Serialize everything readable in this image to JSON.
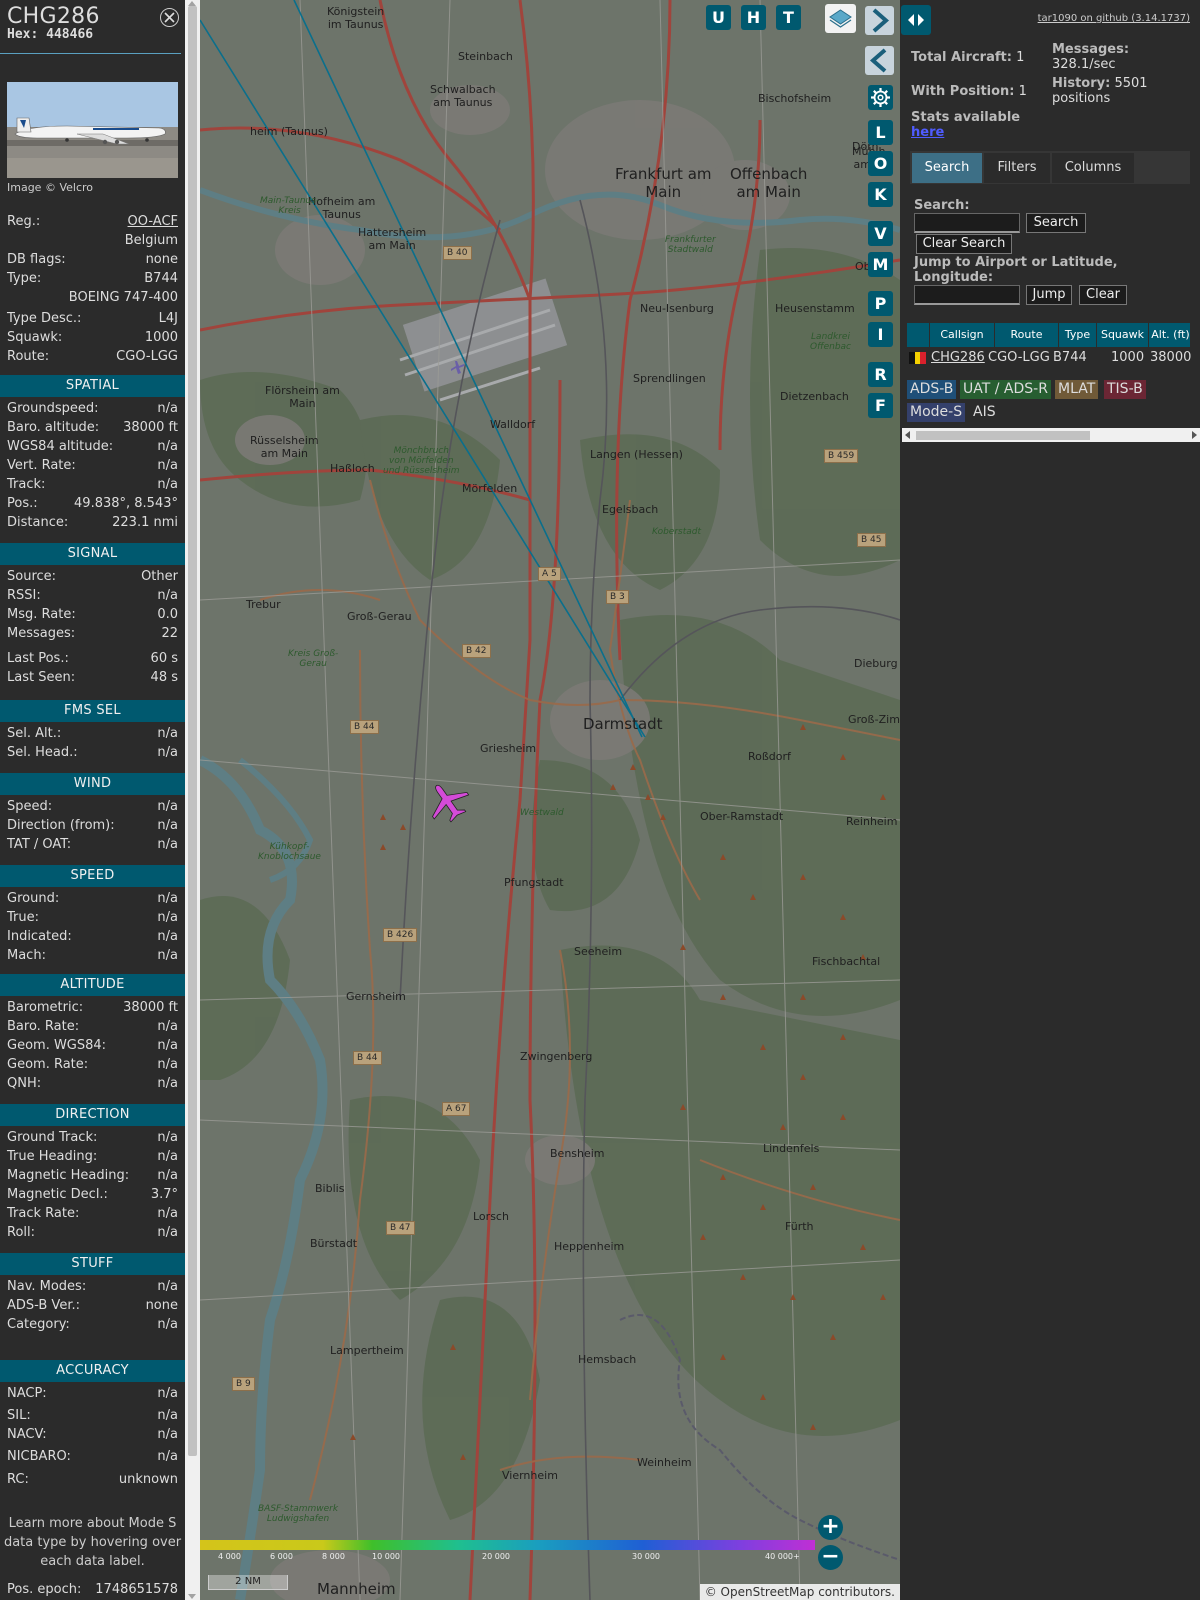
{
  "selected": {
    "callsign": "CHG286",
    "hex": "Hex:  448466",
    "image_credit": "Image © Velcro",
    "fields": [
      {
        "k": "Reg.:",
        "v": "OO-ACF"
      },
      {
        "k": "",
        "v": "Belgium"
      },
      {
        "k": "DB flags:",
        "v": "none"
      },
      {
        "k": "Type:",
        "v": "B744"
      },
      {
        "k": "",
        "v": "BOEING 747-400"
      },
      {
        "k": "Type Desc.:",
        "v": "L4J"
      },
      {
        "k": "Squawk:",
        "v": "1000"
      },
      {
        "k": "Route:",
        "v": "CGO-LGG"
      }
    ]
  },
  "sections": {
    "spatial": {
      "title": "SPATIAL",
      "rows": [
        {
          "k": "Groundspeed:",
          "v": "n/a"
        },
        {
          "k": "Baro. altitude:",
          "v": "38000 ft"
        },
        {
          "k": "WGS84 altitude:",
          "v": "n/a"
        },
        {
          "k": "Vert. Rate:",
          "v": "n/a"
        },
        {
          "k": "Track:",
          "v": "n/a"
        },
        {
          "k": "Pos.:",
          "v": "49.838°, 8.543°"
        },
        {
          "k": "Distance:",
          "v": "223.1 nmi"
        }
      ]
    },
    "signal": {
      "title": "SIGNAL",
      "rows": [
        {
          "k": "Source:",
          "v": "Other"
        },
        {
          "k": "RSSI:",
          "v": "n/a"
        },
        {
          "k": "Msg. Rate:",
          "v": "0.0"
        },
        {
          "k": "Messages:",
          "v": "22"
        },
        {
          "k": "Last Pos.:",
          "v": "60 s"
        },
        {
          "k": "Last Seen:",
          "v": "48 s"
        }
      ]
    },
    "fms": {
      "title": "FMS SEL",
      "rows": [
        {
          "k": "Sel. Alt.:",
          "v": "n/a"
        },
        {
          "k": "Sel. Head.:",
          "v": "n/a"
        }
      ]
    },
    "wind": {
      "title": "WIND",
      "rows": [
        {
          "k": "Speed:",
          "v": "n/a"
        },
        {
          "k": "Direction (from):",
          "v": "n/a"
        },
        {
          "k": "TAT / OAT:",
          "v": "n/a"
        }
      ]
    },
    "speed": {
      "title": "SPEED",
      "rows": [
        {
          "k": "Ground:",
          "v": "n/a"
        },
        {
          "k": "True:",
          "v": "n/a"
        },
        {
          "k": "Indicated:",
          "v": "n/a"
        },
        {
          "k": "Mach:",
          "v": "n/a"
        }
      ]
    },
    "altitude": {
      "title": "ALTITUDE",
      "rows": [
        {
          "k": "Barometric:",
          "v": "38000 ft"
        },
        {
          "k": "Baro. Rate:",
          "v": "n/a"
        },
        {
          "k": "Geom. WGS84:",
          "v": "n/a"
        },
        {
          "k": "Geom. Rate:",
          "v": "n/a"
        },
        {
          "k": "QNH:",
          "v": "n/a"
        }
      ]
    },
    "direction": {
      "title": "DIRECTION",
      "rows": [
        {
          "k": "Ground Track:",
          "v": "n/a"
        },
        {
          "k": "True Heading:",
          "v": "n/a"
        },
        {
          "k": "Magnetic Heading:",
          "v": "n/a"
        },
        {
          "k": "Magnetic Decl.:",
          "v": "3.7°"
        },
        {
          "k": "Track Rate:",
          "v": "n/a"
        },
        {
          "k": "Roll:",
          "v": "n/a"
        }
      ]
    },
    "stuff": {
      "title": "STUFF",
      "rows": [
        {
          "k": "Nav. Modes:",
          "v": "n/a"
        },
        {
          "k": "ADS-B Ver.:",
          "v": "none"
        },
        {
          "k": "Category:",
          "v": "n/a"
        }
      ]
    },
    "accuracy": {
      "title": "ACCURACY",
      "rows": [
        {
          "k": "NACP:",
          "v": "n/a"
        },
        {
          "k": "SIL:",
          "v": "n/a"
        },
        {
          "k": "NACV:",
          "v": "n/a"
        },
        {
          "k": "NICBARO:",
          "v": "n/a"
        },
        {
          "k": "RC:",
          "v": "unknown"
        }
      ]
    },
    "note_lines": [
      "Learn more about Mode S",
      "data type by hovering over",
      "each data label."
    ],
    "epoch": {
      "k": "Pos. epoch:",
      "v": "1748651578"
    }
  },
  "map": {
    "top_buttons": [
      "U",
      "H",
      "T"
    ],
    "side_buttons": [
      "L",
      "O",
      "K",
      "V",
      "M",
      "P",
      "I",
      "R",
      "F"
    ],
    "towns": [
      {
        "name": "Königstein\nim Taunus"
      },
      {
        "name": "Steinbach"
      },
      {
        "name": "Schwalbach\nam Taunus"
      },
      {
        "name": "heim (Taunus)"
      },
      {
        "name": "Hofheim am\nTaunus"
      },
      {
        "name": "Hattersheim\nam Main"
      },
      {
        "name": "Frankfurt am\nMain"
      },
      {
        "name": "Offenbach\nam Main"
      },
      {
        "name": "Bischofsheim"
      },
      {
        "name": "Dörn"
      },
      {
        "name": "Mühlh\nam M"
      },
      {
        "name": "Ob"
      },
      {
        "name": "Neu-Isenburg"
      },
      {
        "name": "Heusenstamm"
      },
      {
        "name": "Flörsheim am\nMain"
      },
      {
        "name": "Sprendlingen"
      },
      {
        "name": "Dietzenbach"
      },
      {
        "name": "Rüsselsheim\nam Main"
      },
      {
        "name": "Walldorf"
      },
      {
        "name": "Langen (Hessen)"
      },
      {
        "name": "Haßloch"
      },
      {
        "name": "Mörfelden"
      },
      {
        "name": "Egelsbach"
      },
      {
        "name": "Trebur"
      },
      {
        "name": "Groß-Gerau"
      },
      {
        "name": "Dieburg"
      },
      {
        "name": "Darmstadt"
      },
      {
        "name": "Groß-Zimmern"
      },
      {
        "name": "Griesheim"
      },
      {
        "name": "Roßdorf"
      },
      {
        "name": "Ober-Ramstadt"
      },
      {
        "name": "Reinheim"
      },
      {
        "name": "Pfungstadt"
      },
      {
        "name": "Seeheim"
      },
      {
        "name": "Fischbachtal"
      },
      {
        "name": "Gernsheim"
      },
      {
        "name": "Zwingenberg"
      },
      {
        "name": "Biblis"
      },
      {
        "name": "Bensheim"
      },
      {
        "name": "Lindenfels"
      },
      {
        "name": "Lorsch"
      },
      {
        "name": "Fürth"
      },
      {
        "name": "Bürstadt"
      },
      {
        "name": "Heppenheim"
      },
      {
        "name": "Lampertheim"
      },
      {
        "name": "Hemsbach"
      },
      {
        "name": "Viernheim"
      },
      {
        "name": "Weinheim"
      },
      {
        "name": "Mannheim"
      }
    ],
    "forests": [
      "Main-Taunus-\nKreis",
      "Frankfurter\nStadtwald",
      "Mönchbruch\nvon Mörfelden\nund Rüsselsheim",
      "Koberstadt",
      "Kreis Groß-\nGerau",
      "Westwald",
      "Kühkopf-\nKnoblochsaue",
      "Landkrei\nOffenbac",
      "BASF-Stammwerk\nLudwigshafen"
    ],
    "roads": [
      "B 40",
      "B 459",
      "B 45",
      "A 5",
      "B 3",
      "B 42",
      "B 44",
      "B 426",
      "B 44",
      "A 67",
      "B 47",
      "B 9"
    ],
    "altitude_legend": [
      "4 000",
      "6 000",
      "8 000",
      "10 000",
      "20 000",
      "30 000",
      "40 000+"
    ],
    "scale": "2 NM",
    "attribution_prefix": "©",
    "attribution_link": "OpenStreetMap",
    "attribution_suffix": "contributors."
  },
  "sidebar": {
    "github": "tar1090 on github (3.14.1737)",
    "total_label": "Total Aircraft:",
    "total_value": "1",
    "withpos_label": "With Position:",
    "withpos_value": "1",
    "messages_label": "Messages:",
    "messages_value": "328.1/sec",
    "history_label": "History:",
    "history_value": "5501",
    "history_unit": "positions",
    "stats_label": "Stats available",
    "stats_link": "here",
    "tabs": [
      "Search",
      "Filters",
      "Columns"
    ],
    "search_label": "Search:",
    "search_button": "Search",
    "clear_search_button": "Clear Search",
    "jump_label": "Jump to Airport or Latitude,\nLongitude:",
    "jump_button": "Jump",
    "clear_button": "Clear",
    "columns": [
      "Callsign",
      "Route",
      "Type",
      "Squawk",
      "Alt. (ft)"
    ],
    "row": {
      "callsign": "CHG286",
      "route": "CGO-LGG",
      "type": "B744",
      "squawk": "1000",
      "alt": "38000"
    },
    "sources": [
      {
        "label": "ADS-B",
        "color": "#1f4f78"
      },
      {
        "label": "UAT / ADS-R",
        "color": "#275e31"
      },
      {
        "label": "MLAT",
        "color": "#705a38"
      },
      {
        "label": "TIS-B",
        "color": "#6b2634"
      },
      {
        "label": "Mode-S",
        "color": "#34406b"
      },
      {
        "label": "AIS",
        "color": "#2b2b2b"
      }
    ]
  }
}
